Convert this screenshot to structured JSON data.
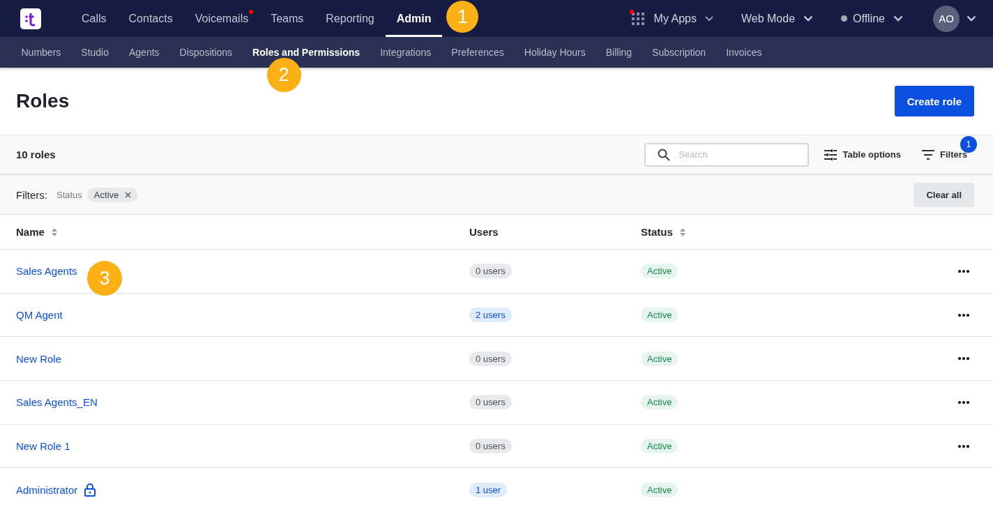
{
  "top_nav": {
    "items": [
      {
        "label": "Calls",
        "selected": false,
        "notification": false
      },
      {
        "label": "Contacts",
        "selected": false,
        "notification": false
      },
      {
        "label": "Voicemails",
        "selected": false,
        "notification": true
      },
      {
        "label": "Teams",
        "selected": false,
        "notification": false
      },
      {
        "label": "Reporting",
        "selected": false,
        "notification": false
      },
      {
        "label": "Admin",
        "selected": true,
        "notification": false,
        "marker": "1"
      }
    ],
    "apps": {
      "label": "My Apps",
      "notification": true
    },
    "mode": {
      "label": "Web Mode"
    },
    "presence": {
      "label": "Offline"
    },
    "avatar": {
      "initials": "AO"
    }
  },
  "sub_nav": [
    {
      "label": "Numbers",
      "selected": false
    },
    {
      "label": "Studio",
      "selected": false
    },
    {
      "label": "Agents",
      "selected": false
    },
    {
      "label": "Dispositions",
      "selected": false
    },
    {
      "label": "Roles and Permissions",
      "selected": true,
      "marker": "2"
    },
    {
      "label": "Integrations",
      "selected": false
    },
    {
      "label": "Preferences",
      "selected": false
    },
    {
      "label": "Holiday Hours",
      "selected": false
    },
    {
      "label": "Billing",
      "selected": false
    },
    {
      "label": "Subscription",
      "selected": false
    },
    {
      "label": "Invoices",
      "selected": false
    }
  ],
  "page": {
    "title": "Roles",
    "create_button": "Create role"
  },
  "toolbar": {
    "count": "10 roles",
    "search": {
      "placeholder": "Search"
    },
    "table_options": "Table options",
    "filters": "Filters",
    "filters_badge": "1"
  },
  "filter_bar": {
    "label": "Filters:",
    "field": "Status",
    "chip": "Active",
    "clear": "Clear all"
  },
  "table": {
    "columns": [
      {
        "label": "Name",
        "sortable": true
      },
      {
        "label": "Users",
        "sortable": false
      },
      {
        "label": "Status",
        "sortable": true
      }
    ],
    "rows": [
      {
        "name": "Sales Agents",
        "users": "0 users",
        "has_users": false,
        "status": "Active",
        "locked": false,
        "marker": "3"
      },
      {
        "name": "QM Agent",
        "users": "2 users",
        "has_users": true,
        "status": "Active",
        "locked": false
      },
      {
        "name": "New Role",
        "users": "0 users",
        "has_users": false,
        "status": "Active",
        "locked": false
      },
      {
        "name": "Sales Agents_EN",
        "users": "0 users",
        "has_users": false,
        "status": "Active",
        "locked": false
      },
      {
        "name": "New Role 1",
        "users": "0 users",
        "has_users": false,
        "status": "Active",
        "locked": false
      },
      {
        "name": "Administrator",
        "users": "1 user",
        "has_users": true,
        "status": "Active",
        "locked": true
      }
    ]
  }
}
